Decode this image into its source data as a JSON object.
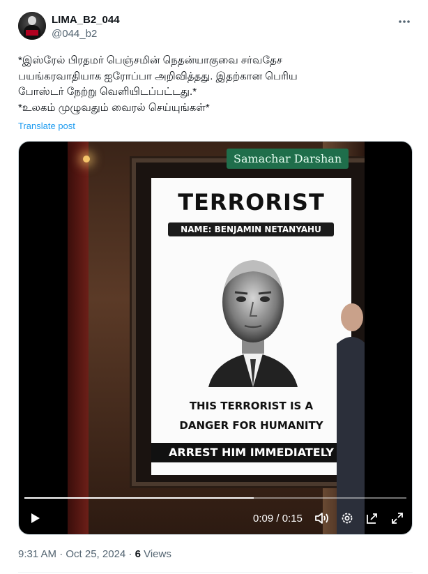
{
  "author": {
    "display_name": "LIMA_B2_044",
    "handle": "@044_b2"
  },
  "tweet": {
    "text": "*இஸ்ரேல் பிரதமர் பெஞ்சமின் நெதன்யாகுவை சர்வதேச\nபயங்கரவாதியாக ஐரோப்பா அறிவித்தது. இதற்கான பெரிய\nபோஸ்டர் நேற்று வெளியிடப்பட்டது.*\n*உலகம் முழுவதும் வைரல் செய்யுங்கள்*",
    "translate_label": "Translate post",
    "more_icon": "more-horizontal-icon"
  },
  "video": {
    "watermark": "Samachar Darshan",
    "poster": {
      "title": "TERRORIST",
      "name_line": "NAME: BENJAMIN NETANYAHU",
      "line1": "THIS TERRORIST IS A",
      "line2": "DANGER FOR HUMANITY",
      "cta": "ARREST HIM IMMEDIATELY"
    },
    "time_display": "0:09 / 0:15",
    "progress_fraction": 0.6,
    "icons": [
      "play-icon",
      "volume-icon",
      "settings-icon",
      "pip-icon",
      "fullscreen-icon"
    ]
  },
  "meta": {
    "time": "9:31 AM · Oct 25, 2024 · ",
    "views_count": "6",
    "views_label": " Views"
  },
  "colors": {
    "link": "#1d9bf0",
    "secondary_text": "#536471",
    "watermark_bg": "#1f6e4b"
  }
}
